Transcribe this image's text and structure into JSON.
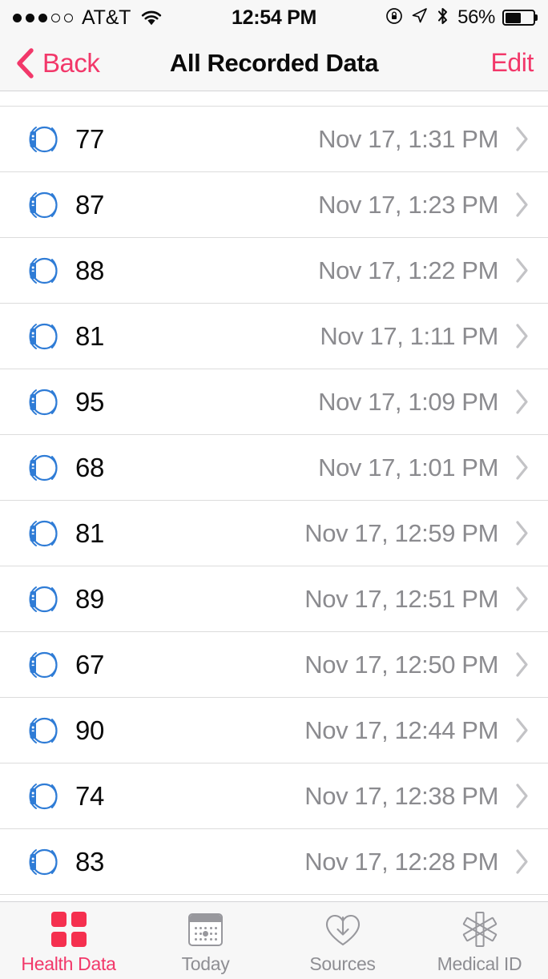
{
  "status_bar": {
    "signal_dots_filled": 3,
    "signal_dots_total": 5,
    "carrier": "AT&T",
    "wifi_icon": "wifi-icon",
    "time": "12:54 PM",
    "rotation_lock_icon": "rotation-lock-icon",
    "location_icon": "location-arrow-icon",
    "bluetooth_icon": "bluetooth-icon",
    "battery_percent": "56%",
    "battery_level": 56
  },
  "nav_bar": {
    "back_label": "Back",
    "back_icon": "chevron-left-icon",
    "title": "All Recorded Data",
    "edit_label": "Edit"
  },
  "colors": {
    "accent_pink": "#F2386A",
    "tab_active": "#F5304F",
    "watch_blue": "#2F7CD6",
    "secondary_text": "#8B8B8F",
    "separator": "#DCDCDC"
  },
  "list": {
    "source_icon": "apple-watch-icon",
    "disclosure_icon": "chevron-right-icon",
    "rows": [
      {
        "value": "77",
        "date": "Nov 17, 1:31 PM"
      },
      {
        "value": "87",
        "date": "Nov 17, 1:23 PM"
      },
      {
        "value": "88",
        "date": "Nov 17, 1:22 PM"
      },
      {
        "value": "81",
        "date": "Nov 17, 1:11 PM"
      },
      {
        "value": "95",
        "date": "Nov 17, 1:09 PM"
      },
      {
        "value": "68",
        "date": "Nov 17, 1:01 PM"
      },
      {
        "value": "81",
        "date": "Nov 17, 12:59 PM"
      },
      {
        "value": "89",
        "date": "Nov 17, 12:51 PM"
      },
      {
        "value": "67",
        "date": "Nov 17, 12:50 PM"
      },
      {
        "value": "90",
        "date": "Nov 17, 12:44 PM"
      },
      {
        "value": "74",
        "date": "Nov 17, 12:38 PM"
      },
      {
        "value": "83",
        "date": "Nov 17, 12:28 PM"
      }
    ]
  },
  "tab_bar": {
    "tabs": [
      {
        "label": "Health Data",
        "icon": "health-data-grid-icon",
        "active": true
      },
      {
        "label": "Today",
        "icon": "calendar-icon",
        "active": false
      },
      {
        "label": "Sources",
        "icon": "heart-download-icon",
        "active": false
      },
      {
        "label": "Medical ID",
        "icon": "star-of-life-icon",
        "active": false
      }
    ]
  }
}
